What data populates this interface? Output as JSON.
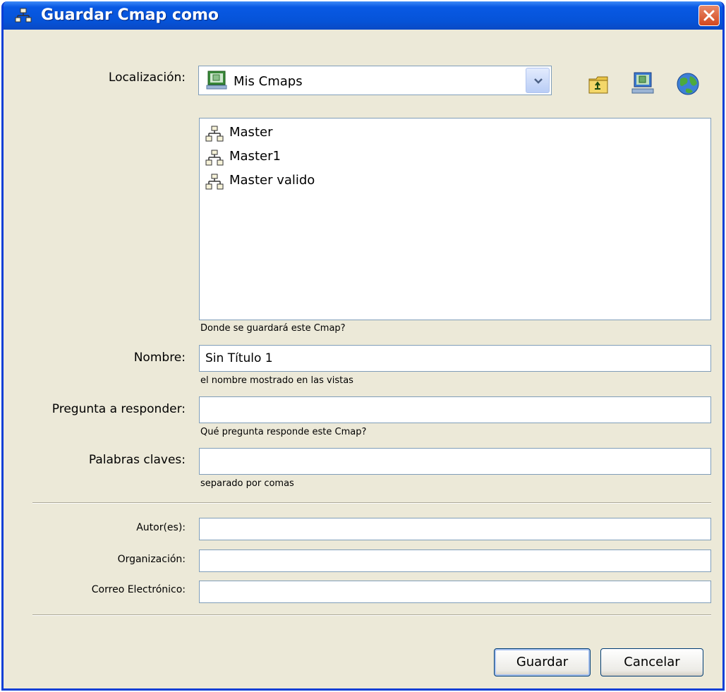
{
  "window": {
    "title": "Guardar Cmap como"
  },
  "location": {
    "label": "Localización:",
    "selected": "Mis Cmaps"
  },
  "toolbar": {
    "up_icon": "folder-up-icon",
    "my_cmaps_icon": "computer-icon",
    "places_icon": "network-globe-icon"
  },
  "files": [
    {
      "name": "Master"
    },
    {
      "name": "Master1"
    },
    {
      "name": "Master valido"
    }
  ],
  "hints": {
    "location": "Donde se guardará este Cmap?",
    "name": "el nombre mostrado en las vistas",
    "question": "Qué pregunta responde este Cmap?",
    "keywords": "separado por comas"
  },
  "form": {
    "name_label": "Nombre:",
    "name_value": "Sin Título 1",
    "question_label": "Pregunta a responder:",
    "question_value": "",
    "keywords_label": "Palabras claves:",
    "keywords_value": "",
    "authors_label": "Autor(es):",
    "authors_value": "",
    "organization_label": "Organización:",
    "organization_value": "",
    "email_label": "Correo Electrónico:",
    "email_value": ""
  },
  "buttons": {
    "save": "Guardar",
    "cancel": "Cancelar"
  }
}
